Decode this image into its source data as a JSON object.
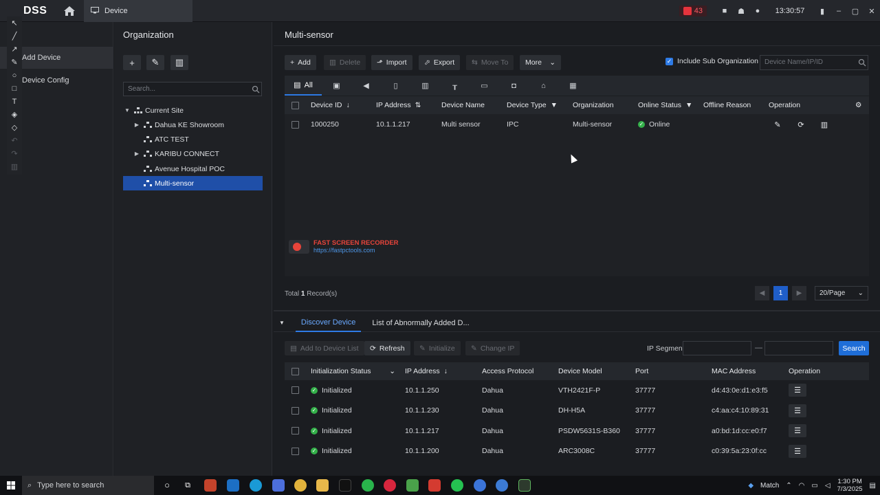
{
  "titlebar": {
    "app_name": "DSS",
    "tab_label": "Device",
    "alarm_count": "43",
    "clock": "13:30:57"
  },
  "left_nav": {
    "items": [
      {
        "label": "Add Device"
      },
      {
        "label": "Device Config"
      }
    ]
  },
  "organization": {
    "title": "Organization",
    "search_placeholder": "Search...",
    "tree": [
      {
        "label": "Current Site"
      },
      {
        "label": "Dahua KE Showroom"
      },
      {
        "label": "ATC TEST"
      },
      {
        "label": "KARIBU CONNECT"
      },
      {
        "label": "Avenue Hospital POC"
      },
      {
        "label": "Multi-sensor"
      }
    ]
  },
  "main": {
    "title": "Multi-sensor",
    "toolbar": {
      "add": "Add",
      "delete": "Delete",
      "import": "Import",
      "export": "Export",
      "move_to": "Move To",
      "more": "More"
    },
    "include_sub_org": "Include Sub Organization",
    "device_search_placeholder": "Device Name/IP/ID",
    "type_filter_all": "All",
    "columns": [
      "Device ID",
      "IP Address",
      "Device Name",
      "Device Type",
      "Organization",
      "Online Status",
      "Offline Reason",
      "Operation"
    ],
    "rows": [
      {
        "device_id": "1000250",
        "ip": "10.1.1.217",
        "name": "Multi sensor",
        "type": "IPC",
        "org": "Multi-sensor",
        "status": "Online",
        "reason": ""
      }
    ],
    "total_prefix": "Total",
    "total_count": "1",
    "total_suffix": "Record(s)",
    "page": "1",
    "page_size": "20/Page"
  },
  "watermark": {
    "title": "FAST SCREEN RECORDER",
    "url": "https://fastpctools.com"
  },
  "discover": {
    "tabs": [
      "Discover Device",
      "List of Abnormally Added D..."
    ],
    "buttons": {
      "add_to_list": "Add to Device List",
      "refresh": "Refresh",
      "initialize": "Initialize",
      "change_ip": "Change IP"
    },
    "ip_segment_label": "IP Segment",
    "ip_dash": "—",
    "search": "Search",
    "columns": [
      "Initialization Status",
      "IP Address",
      "Access Protocol",
      "Device Model",
      "Port",
      "MAC Address",
      "Operation"
    ],
    "rows": [
      {
        "status": "Initialized",
        "ip": "10.1.1.250",
        "protocol": "Dahua",
        "model": "VTH2421F-P",
        "port": "37777",
        "mac": "d4:43:0e:d1:e3:f5"
      },
      {
        "status": "Initialized",
        "ip": "10.1.1.230",
        "protocol": "Dahua",
        "model": "DH-H5A",
        "port": "37777",
        "mac": "c4:aa:c4:10:89:31"
      },
      {
        "status": "Initialized",
        "ip": "10.1.1.217",
        "protocol": "Dahua",
        "model": "PSDW5631S-B360",
        "port": "37777",
        "mac": "a0:bd:1d:cc:e0:f7"
      },
      {
        "status": "Initialized",
        "ip": "10.1.1.200",
        "protocol": "Dahua",
        "model": "ARC3008C",
        "port": "37777",
        "mac": "c0:39:5a:23:0f:cc"
      }
    ]
  },
  "taskbar": {
    "search_placeholder": "Type here to search",
    "weather": "Match",
    "time": "1:30 PM",
    "date": "7/3/2025"
  },
  "colors": {
    "accent": "#2e7be6",
    "selection": "#1f4fa8",
    "online": "#34b14a",
    "alarm": "#e5343d"
  }
}
